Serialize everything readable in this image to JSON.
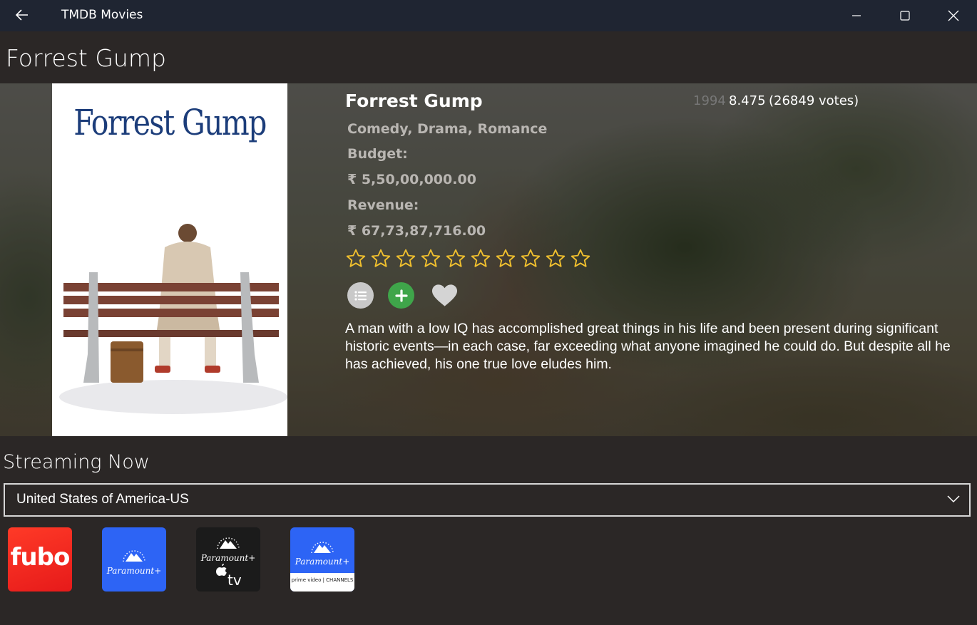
{
  "window": {
    "title": "TMDB Movies"
  },
  "page": {
    "title": "Forrest Gump"
  },
  "movie": {
    "poster_title": "Forrest Gump",
    "title": "Forrest Gump",
    "year": "1994",
    "rating": "8.475",
    "votes": "(26849 votes)",
    "genres": "Comedy, Drama, Romance",
    "budget_label": "Budget:",
    "budget_value": "₹ 5,50,00,000.00",
    "revenue_label": "Revenue:",
    "revenue_value": "₹ 67,73,87,716.00",
    "stars_total": 10,
    "stars_filled": 0,
    "overview": "A man with a low IQ has accomplished great things in his life and been present during significant historic events—in each case, far exceeding what anyone imagined he could do. But despite all he has achieved, his one true love eludes him."
  },
  "streaming": {
    "title": "Streaming Now",
    "region_selected": "United States of America-US",
    "providers": [
      {
        "name": "fubo",
        "label": "fubo"
      },
      {
        "name": "paramount-plus",
        "label": "Paramount+"
      },
      {
        "name": "paramount-plus-apple-tv",
        "label": "Paramount+",
        "sub": "tv"
      },
      {
        "name": "paramount-plus-prime-video",
        "label": "Paramount+",
        "sub": "prime video | CHANNELS"
      }
    ]
  },
  "colors": {
    "titlebar": "#1f2532",
    "background": "#2b2726",
    "star_outline": "#f2c12e",
    "add_button": "#3fa54a"
  }
}
